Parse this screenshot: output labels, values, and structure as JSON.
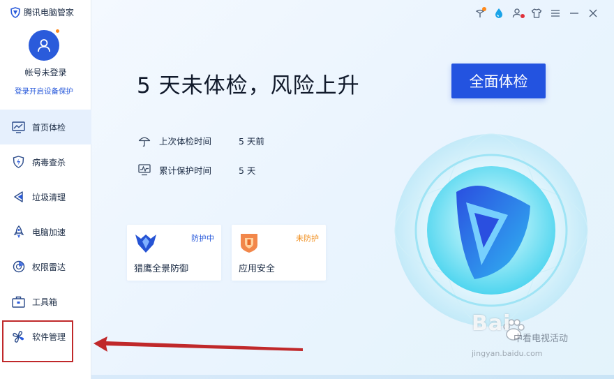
{
  "app": {
    "title": "腾讯电脑管家"
  },
  "account": {
    "name": "帐号未登录",
    "login_link": "登录开启设备保护"
  },
  "nav": {
    "items": [
      {
        "label": "首页体检",
        "icon": "monitor-chart-icon",
        "active": true
      },
      {
        "label": "病毒查杀",
        "icon": "lightning-shield-icon"
      },
      {
        "label": "垃圾清理",
        "icon": "triangle-clean-icon"
      },
      {
        "label": "电脑加速",
        "icon": "rocket-icon"
      },
      {
        "label": "权限雷达",
        "icon": "radar-icon"
      },
      {
        "label": "工具箱",
        "icon": "toolbox-icon"
      },
      {
        "label": "软件管理",
        "icon": "clover-apps-icon"
      }
    ]
  },
  "main": {
    "headline": "5 天未体检，风险上升",
    "scan_button": "全面体检",
    "info": [
      {
        "label": "上次体检时间",
        "value": "5 天前",
        "icon": "umbrella-icon"
      },
      {
        "label": "累计保护时间",
        "value": "5 天",
        "icon": "pulse-monitor-icon"
      }
    ],
    "cards": [
      {
        "title": "猎鹰全景防御",
        "status": "防护中",
        "status_color": "#2a5bdb",
        "icon": "falcon-icon"
      },
      {
        "title": "应用安全",
        "status": "未防护",
        "status_color": "#f08c19",
        "icon": "app-shield-icon"
      }
    ]
  },
  "watermark": {
    "brand": "Bai",
    "text": "中看电视活动",
    "url": "jingyan.baidu.com"
  },
  "colors": {
    "accent": "#2353e0",
    "annotation": "#c0282a"
  }
}
